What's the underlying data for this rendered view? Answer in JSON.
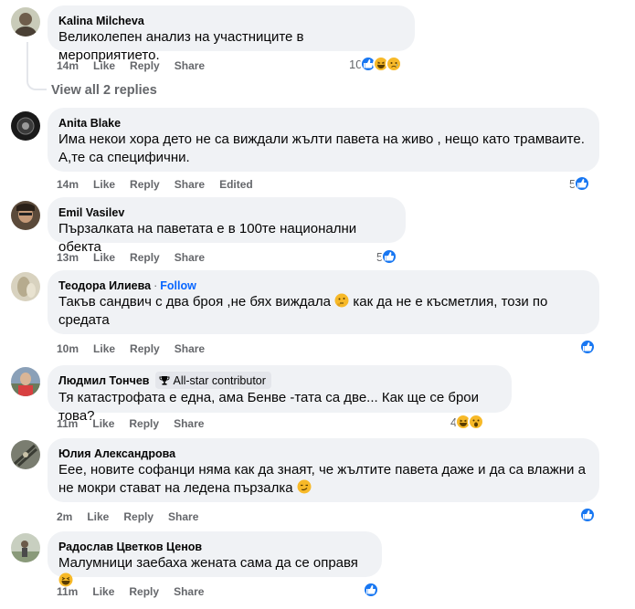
{
  "comments": [
    {
      "name": "Kalina Milcheva",
      "text_lines": [
        "Великолепен анализ на участниците в мероприятието."
      ],
      "time": "14m",
      "like": "Like",
      "reply": "Reply",
      "share": "Share",
      "reaction_count": "10",
      "view_replies": "View all 2 replies"
    },
    {
      "name": "Anita Blake",
      "text_lines": [
        "Има некои хора дето не са виждали жълти павета на живо , нещо като трамваите.",
        "А,те са специфични."
      ],
      "time": "14m",
      "like": "Like",
      "reply": "Reply",
      "share": "Share",
      "edited": "Edited",
      "reaction_count": "5"
    },
    {
      "name": "Emil Vasilev",
      "text_lines": [
        "Пързалката на паветата е в 100те национални обекта"
      ],
      "time": "13m",
      "like": "Like",
      "reply": "Reply",
      "share": "Share",
      "reaction_count": "5"
    },
    {
      "name": "Теодора Илиева",
      "follow_dot": "·",
      "follow": "Follow",
      "text_lines": [
        "Такъв сандвич с два броя ,не бях виждала",
        "как да не е късметлия, този по",
        "средата"
      ],
      "time": "10m",
      "like": "Like",
      "reply": "Reply",
      "share": "Share"
    },
    {
      "name": "Людмил Тончев",
      "badge": "All-star contributor",
      "text_lines": [
        "Тя катастрофата е една, ама Бенве -тата са две... Как ще се брои това?"
      ],
      "time": "11m",
      "like": "Like",
      "reply": "Reply",
      "share": "Share",
      "reaction_count": "4"
    },
    {
      "name": "Юлия Александрова",
      "text_lines": [
        "Еее, новите софанци няма как да знаят, че жълтите павета даже и да са влажни а",
        "не мокри стават на ледена пързалка"
      ],
      "time": "2m",
      "like": "Like",
      "reply": "Reply",
      "share": "Share"
    },
    {
      "name": "Радослав Цветков Ценов",
      "text_lines": [
        "Малумници заебаха жената сама да се оправя"
      ],
      "time": "11m",
      "like": "Like",
      "reply": "Reply",
      "share": "Share"
    }
  ],
  "colors": {
    "bubble": "#f0f2f5",
    "meta": "#65676b",
    "link": "#0866ff",
    "like_blue": "#1877f2",
    "haha_yellow": "#f7b928"
  }
}
